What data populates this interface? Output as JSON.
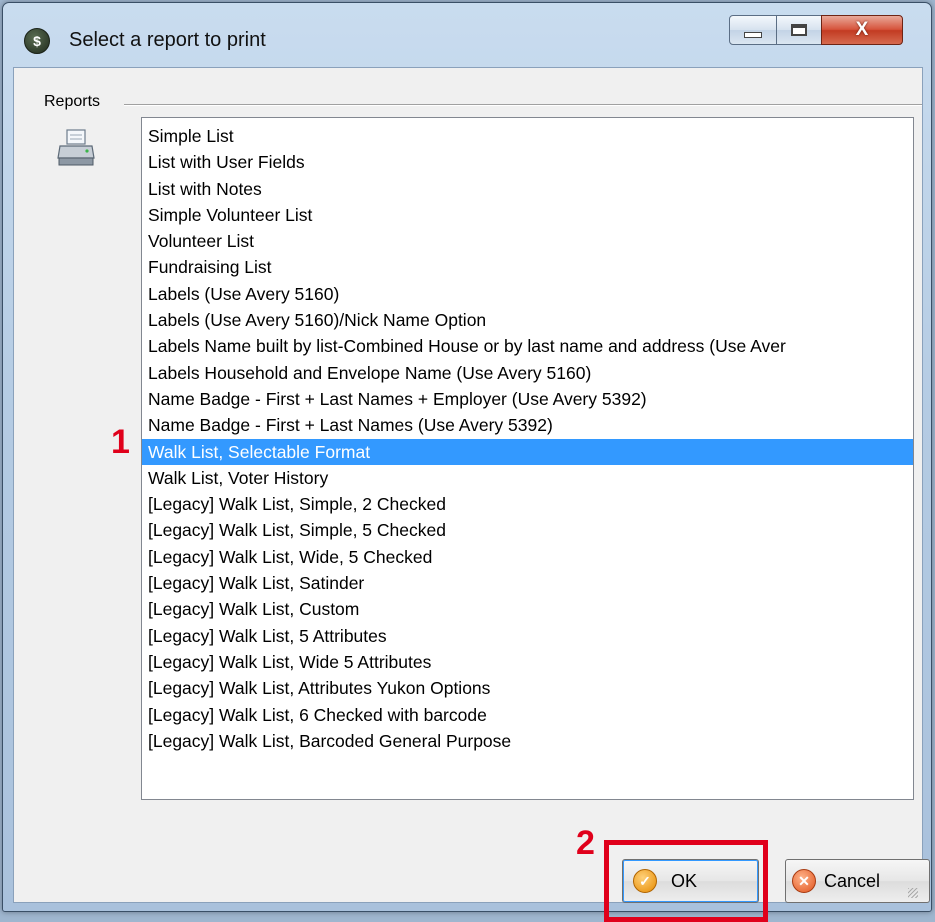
{
  "window": {
    "title": "Select a report to print",
    "close_glyph": "X"
  },
  "group": {
    "label": "Reports"
  },
  "reports": [
    "Simple List",
    "List with User Fields",
    "List with Notes",
    "Simple Volunteer List",
    "Volunteer List",
    "Fundraising List",
    "Labels (Use Avery 5160)",
    "Labels (Use Avery 5160)/Nick Name Option",
    "Labels Name built by list-Combined House or by last name and address (Use Aver",
    "Labels Household and Envelope Name (Use Avery 5160)",
    "Name Badge - First + Last Names + Employer (Use Avery 5392)",
    "Name Badge - First + Last Names (Use Avery 5392)",
    "Walk List, Selectable Format",
    "Walk List, Voter History",
    "[Legacy] Walk List, Simple, 2 Checked",
    "[Legacy] Walk List, Simple, 5 Checked",
    "[Legacy] Walk List, Wide, 5 Checked",
    "[Legacy] Walk List, Satinder",
    "[Legacy] Walk List, Custom",
    "[Legacy] Walk List, 5 Attributes",
    "[Legacy] Walk List, Wide 5 Attributes",
    "[Legacy] Walk List, Attributes Yukon Options",
    "[Legacy] Walk List, 6 Checked with barcode",
    "[Legacy] Walk List, Barcoded General Purpose"
  ],
  "selected_report": "Walk List, Selectable Format",
  "annotations": {
    "step1": "1",
    "step2": "2"
  },
  "buttons": {
    "ok": "OK",
    "cancel": "Cancel"
  },
  "icons": {
    "app": "app-icon",
    "printer": "printer-icon",
    "ok": "ok-check-icon",
    "cancel": "cancel-x-icon"
  },
  "colors": {
    "selection": "#3399ff",
    "annotation": "#e0001b"
  }
}
